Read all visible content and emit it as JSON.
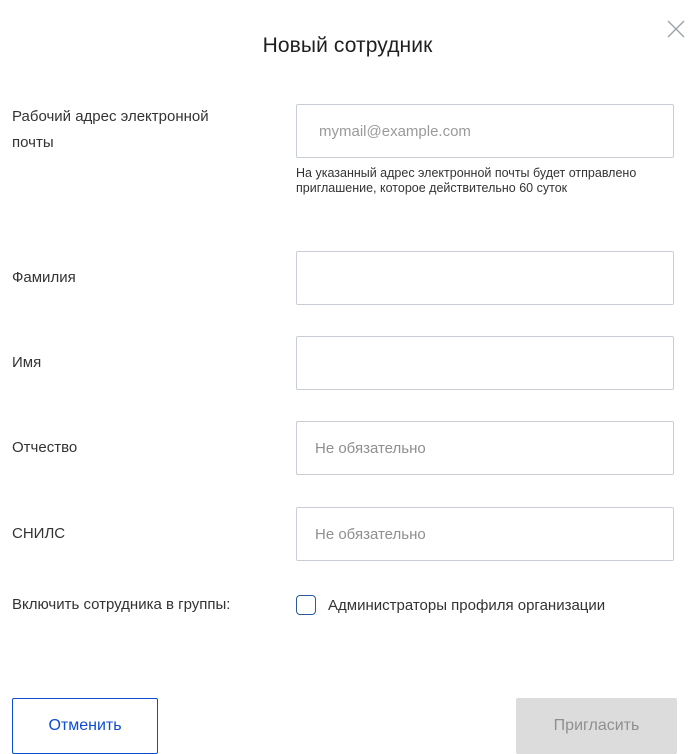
{
  "dialog": {
    "title": "Новый сотрудник",
    "close_icon": "close-icon"
  },
  "form": {
    "email": {
      "label": "Рабочий адрес электронной почты",
      "placeholder": "mymail@example.com",
      "value": "",
      "hint": "На указанный адрес электронной почты будет отправлено приглашение, которое действительно 60 суток"
    },
    "last_name": {
      "label": "Фамилия",
      "placeholder": "",
      "value": ""
    },
    "first_name": {
      "label": "Имя",
      "placeholder": "",
      "value": ""
    },
    "middle_name": {
      "label": "Отчество",
      "placeholder": "Не обязательно",
      "value": ""
    },
    "snils": {
      "label": "СНИЛС",
      "placeholder": "Не обязательно",
      "value": ""
    },
    "groups": {
      "label": "Включить сотрудника в группы:",
      "options": [
        {
          "label": "Администраторы профиля организации",
          "checked": false
        }
      ]
    }
  },
  "actions": {
    "cancel_label": "Отменить",
    "invite_label": "Пригласить"
  },
  "colors": {
    "accent": "#0d4cd3",
    "checkbox_border": "#2b5a9c",
    "input_border": "#c9ced6",
    "disabled_bg": "#dcdcdc",
    "disabled_text": "#8f8f8f"
  }
}
